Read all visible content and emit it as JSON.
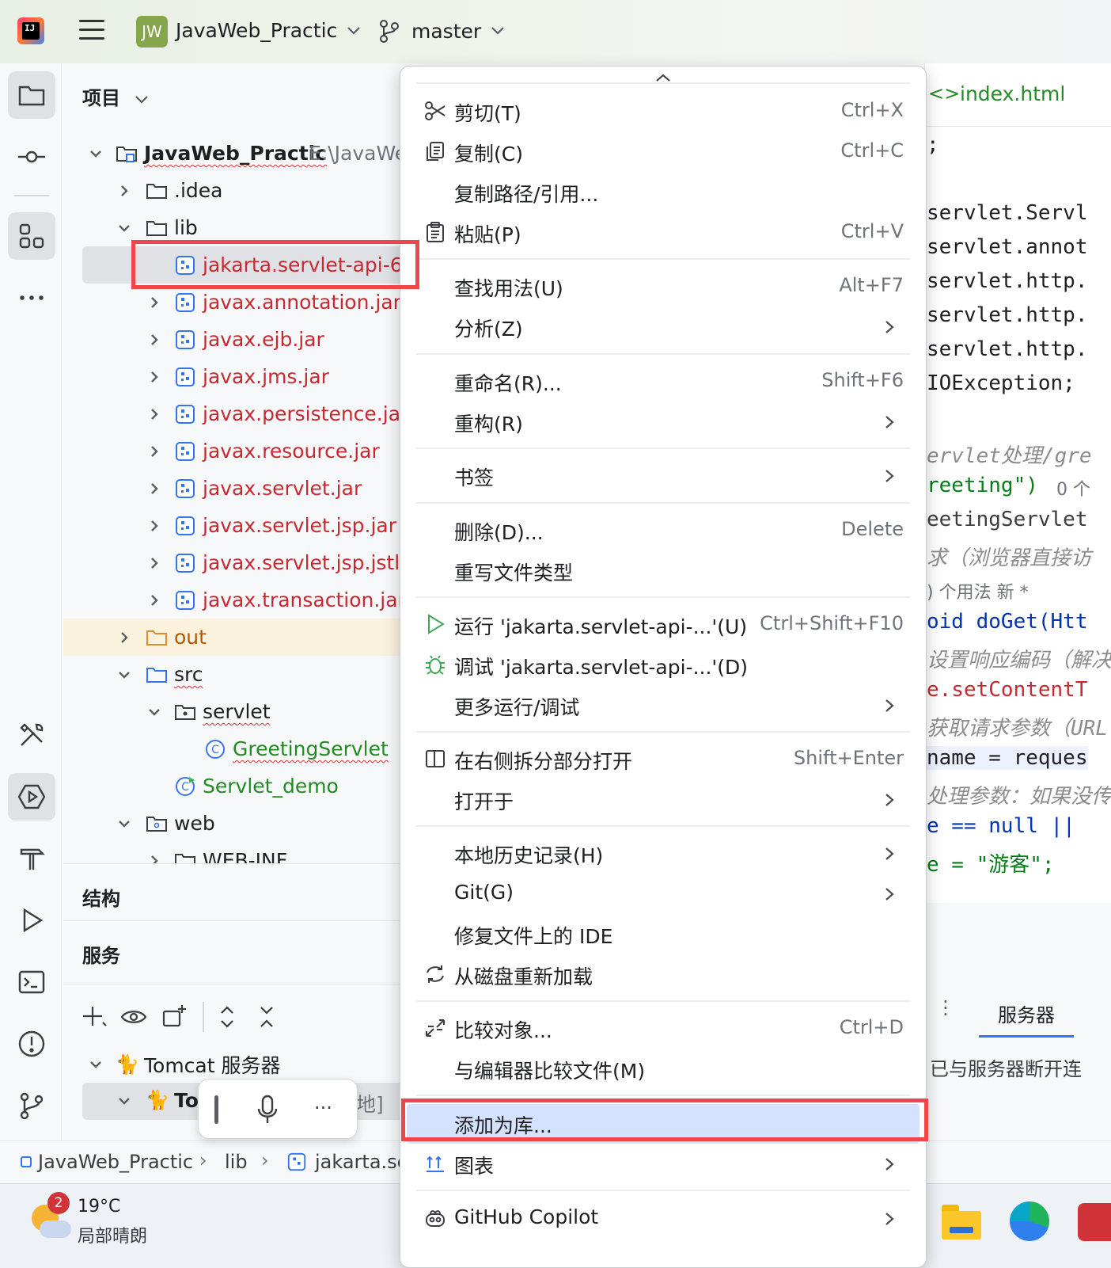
{
  "titlebar": {
    "project_badge": "JW",
    "project_name": "JavaWeb_Practic",
    "branch": "master"
  },
  "project_panel": {
    "header": "项目",
    "tree": [
      {
        "label": "JavaWeb_Practic",
        "path": "E:\\JavaWe",
        "level": 0,
        "expanded": true,
        "type": "module"
      },
      {
        "label": ".idea",
        "level": 1,
        "expanded": false,
        "type": "folder"
      },
      {
        "label": "lib",
        "level": 1,
        "expanded": true,
        "type": "folder"
      },
      {
        "label": "jakarta.servlet-api-6.0.",
        "level": 2,
        "type": "jar",
        "selected": true
      },
      {
        "label": "javax.annotation.jar",
        "level": 2,
        "type": "jar"
      },
      {
        "label": "javax.ejb.jar",
        "level": 2,
        "type": "jar"
      },
      {
        "label": "javax.jms.jar",
        "level": 2,
        "type": "jar"
      },
      {
        "label": "javax.persistence.jar",
        "level": 2,
        "type": "jar"
      },
      {
        "label": "javax.resource.jar",
        "level": 2,
        "type": "jar"
      },
      {
        "label": "javax.servlet.jar",
        "level": 2,
        "type": "jar"
      },
      {
        "label": "javax.servlet.jsp.jar",
        "level": 2,
        "type": "jar"
      },
      {
        "label": "javax.servlet.jsp.jstl.jar",
        "level": 2,
        "type": "jar"
      },
      {
        "label": "javax.transaction.jar",
        "level": 2,
        "type": "jar"
      },
      {
        "label": "out",
        "level": 1,
        "expanded": false,
        "type": "folder-out"
      },
      {
        "label": "src",
        "level": 1,
        "expanded": true,
        "type": "folder-src"
      },
      {
        "label": "servlet",
        "level": 2,
        "expanded": true,
        "type": "package"
      },
      {
        "label": "GreetingServlet",
        "level": 3,
        "type": "class"
      },
      {
        "label": "Servlet_demo",
        "level": 2,
        "type": "run-config"
      },
      {
        "label": "web",
        "level": 1,
        "expanded": true,
        "type": "folder-web"
      },
      {
        "label": "WEB-INF",
        "level": 2,
        "expanded": false,
        "type": "folder"
      }
    ]
  },
  "structure": {
    "title": "结构"
  },
  "services": {
    "title": "服务",
    "tomcat_group": "Tomcat 服务器",
    "tomcat_item": "To",
    "tomcat_item_suffix": "地]"
  },
  "breadcrumb": {
    "items": [
      "JavaWeb_Practic",
      "lib",
      "jakarta.se"
    ]
  },
  "taskbar": {
    "weather_badge": "2",
    "temperature": "19°C",
    "condition": "局部晴朗"
  },
  "editor": {
    "tab": "index.html",
    "lines": [
      ";",
      "",
      "servlet.Servl",
      "servlet.annot",
      "servlet.http.",
      "servlet.http.",
      "servlet.http.",
      "IOException;",
      "",
      "ervlet处理/gre",
      "reeting\")",
      "eetingServlet",
      "求（浏览器直接访",
      ") 个用法   新 *",
      "oid doGet(Htt",
      "设置响应编码（解决",
      "e.setContentT",
      "获取请求参数（URL",
      "name = reques",
      "处理参数：如果没传",
      "e == null || ",
      "e = \"游客\";"
    ],
    "usages_hint": "0 个",
    "server_tab": "服务器",
    "server_status": "已与服务器断开连"
  },
  "context_menu": {
    "items": [
      {
        "label": "剪切(T)",
        "shortcut": "Ctrl+X",
        "icon": "scissors-icon"
      },
      {
        "label": "复制(C)",
        "shortcut": "Ctrl+C",
        "icon": "copy-icon"
      },
      {
        "label": "复制路径/引用...",
        "shortcut": ""
      },
      {
        "label": "粘贴(P)",
        "shortcut": "Ctrl+V",
        "icon": "paste-icon"
      },
      {
        "label": "查找用法(U)",
        "shortcut": "Alt+F7"
      },
      {
        "label": "分析(Z)",
        "submenu": true
      },
      {
        "label": "重命名(R)...",
        "shortcut": "Shift+F6"
      },
      {
        "label": "重构(R)",
        "submenu": true
      },
      {
        "label": "书签",
        "submenu": true
      },
      {
        "label": "删除(D)...",
        "shortcut": "Delete"
      },
      {
        "label": "重写文件类型"
      },
      {
        "label": "运行 'jakarta.servlet-api-...'(U)",
        "shortcut": "Ctrl+Shift+F10",
        "icon": "run-icon"
      },
      {
        "label": "调试 'jakarta.servlet-api-...'(D)",
        "icon": "debug-icon"
      },
      {
        "label": "更多运行/调试",
        "submenu": true
      },
      {
        "label": "在右侧拆分部分打开",
        "shortcut": "Shift+Enter",
        "icon": "split-icon"
      },
      {
        "label": "打开于",
        "submenu": true
      },
      {
        "label": "本地历史记录(H)",
        "submenu": true
      },
      {
        "label": "Git(G)",
        "submenu": true
      },
      {
        "label": "修复文件上的 IDE"
      },
      {
        "label": "从磁盘重新加载",
        "icon": "reload-icon"
      },
      {
        "label": "比较对象...",
        "shortcut": "Ctrl+D",
        "icon": "compare-icon"
      },
      {
        "label": "与编辑器比较文件(M)"
      },
      {
        "label": "添加为库...",
        "highlighted": true
      },
      {
        "label": "图表",
        "submenu": true,
        "icon": "diagram-icon"
      },
      {
        "label": "GitHub Copilot",
        "submenu": true,
        "icon": "copilot-icon"
      }
    ]
  },
  "colors": {
    "accent_red": "#f0454b",
    "highlight": "#d4e2ff",
    "jar_text": "#c8282f",
    "class_text": "#228b22"
  }
}
